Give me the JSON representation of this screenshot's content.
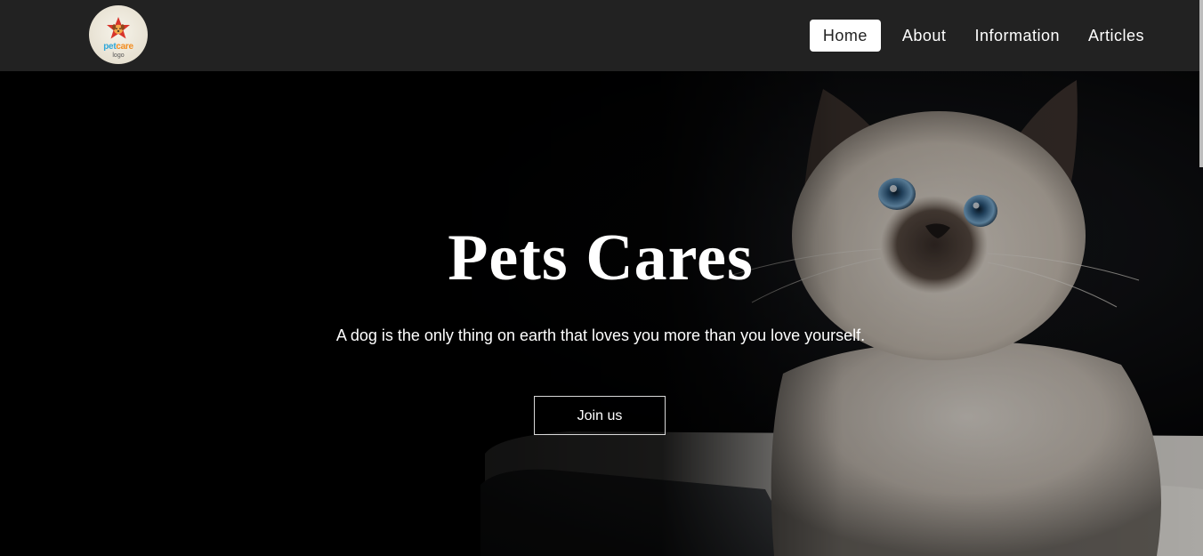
{
  "header": {
    "logo": {
      "brand_pet": "pet",
      "brand_care": "care",
      "subtitle": "logo"
    },
    "nav": [
      {
        "label": "Home",
        "active": true
      },
      {
        "label": "About",
        "active": false
      },
      {
        "label": "Information",
        "active": false
      },
      {
        "label": "Articles",
        "active": false
      }
    ]
  },
  "hero": {
    "title": "Pets Cares",
    "subtitle": "A dog is the only thing on earth that loves you more than you love yourself.",
    "cta_label": "Join us"
  },
  "colors": {
    "navbar": "#222222",
    "hero_bg": "#020203",
    "text": "#ffffff",
    "active_nav_bg": "#ffffff"
  }
}
